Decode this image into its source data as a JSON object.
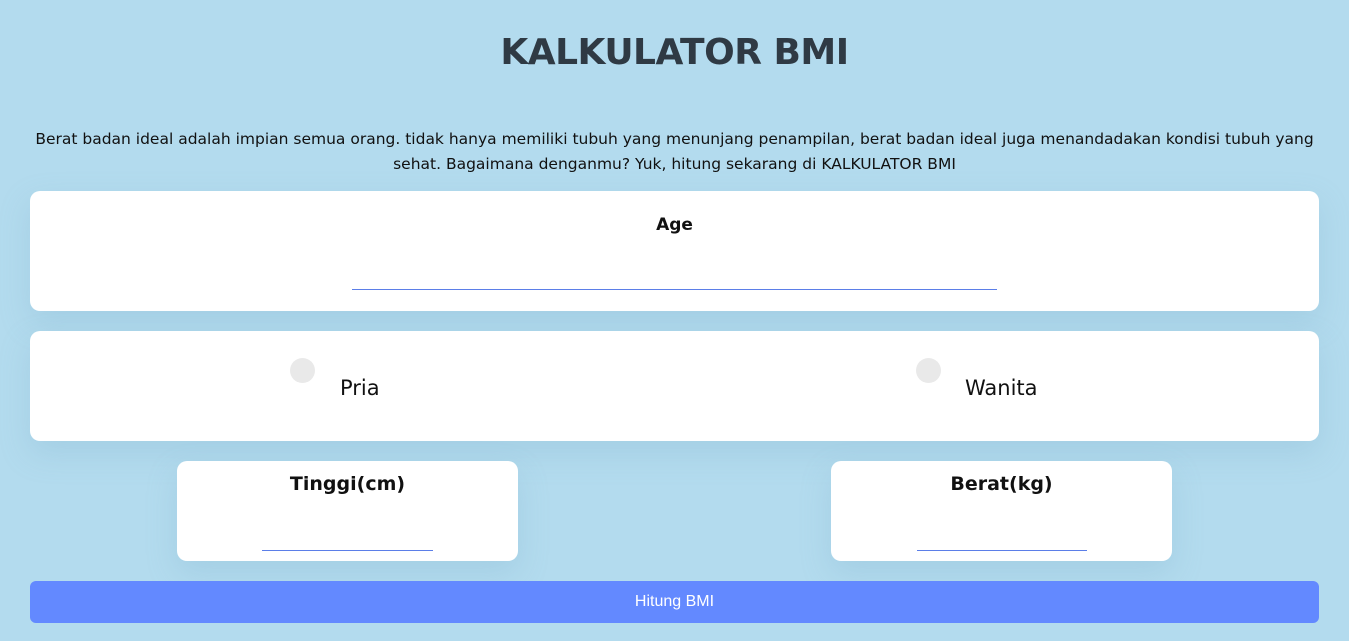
{
  "header": {
    "title": "KALKULATOR BMI",
    "description": "Berat badan ideal adalah impian semua orang. tidak hanya memiliki tubuh yang menunjang penampilan, berat badan ideal juga menandadakan kondisi tubuh yang sehat. Bagaimana denganmu? Yuk, hitung sekarang di KALKULATOR BMI"
  },
  "age": {
    "label": "Age",
    "value": "",
    "placeholder": ""
  },
  "gender": {
    "options": [
      {
        "label": "Pria",
        "checked": false
      },
      {
        "label": "Wanita",
        "checked": false
      }
    ]
  },
  "height": {
    "label": "Tinggi(cm)",
    "value": ""
  },
  "weight": {
    "label": "Berat(kg)",
    "value": ""
  },
  "submit": {
    "label": "Hitung BMI"
  },
  "colors": {
    "background": "#b3dbee",
    "title": "#2f3a44",
    "button": "#6389ff",
    "input_underline": "#5b7ee8",
    "radio": "#e9e9e9"
  }
}
